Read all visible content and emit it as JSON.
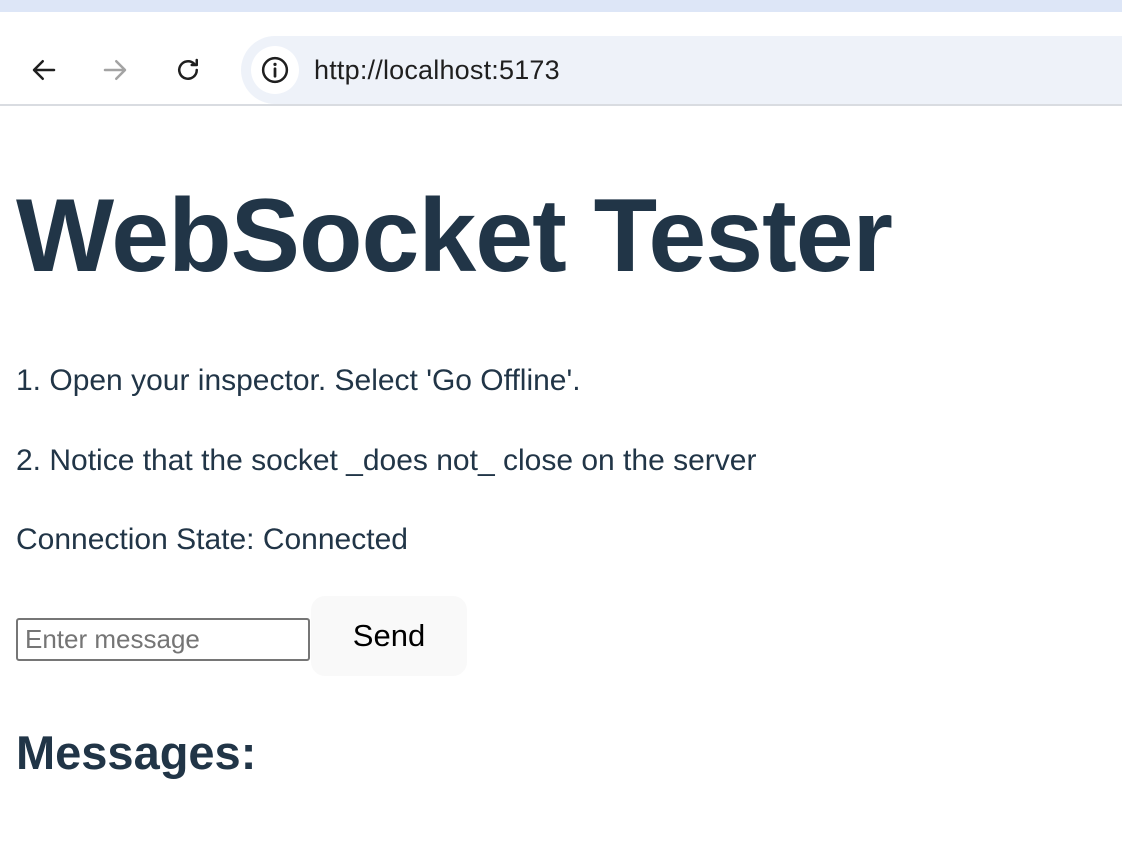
{
  "browser": {
    "url": "http://localhost:5173"
  },
  "page": {
    "title": "WebSocket Tester",
    "steps": [
      "1. Open your inspector. Select 'Go Offline'.",
      "2. Notice that the socket _does not_ close on the server"
    ],
    "connection_state": "Connection State: Connected",
    "message_input": {
      "value": "",
      "placeholder": "Enter message"
    },
    "send_label": "Send",
    "messages_heading": "Messages:"
  },
  "colors": {
    "text": "#213547",
    "omnibox_bg": "#eef2f9",
    "top_strip": "#dde6f7",
    "button_bg": "#f9f9f9"
  },
  "icons": [
    "back-arrow-icon",
    "forward-arrow-icon",
    "reload-icon",
    "info-icon"
  ]
}
